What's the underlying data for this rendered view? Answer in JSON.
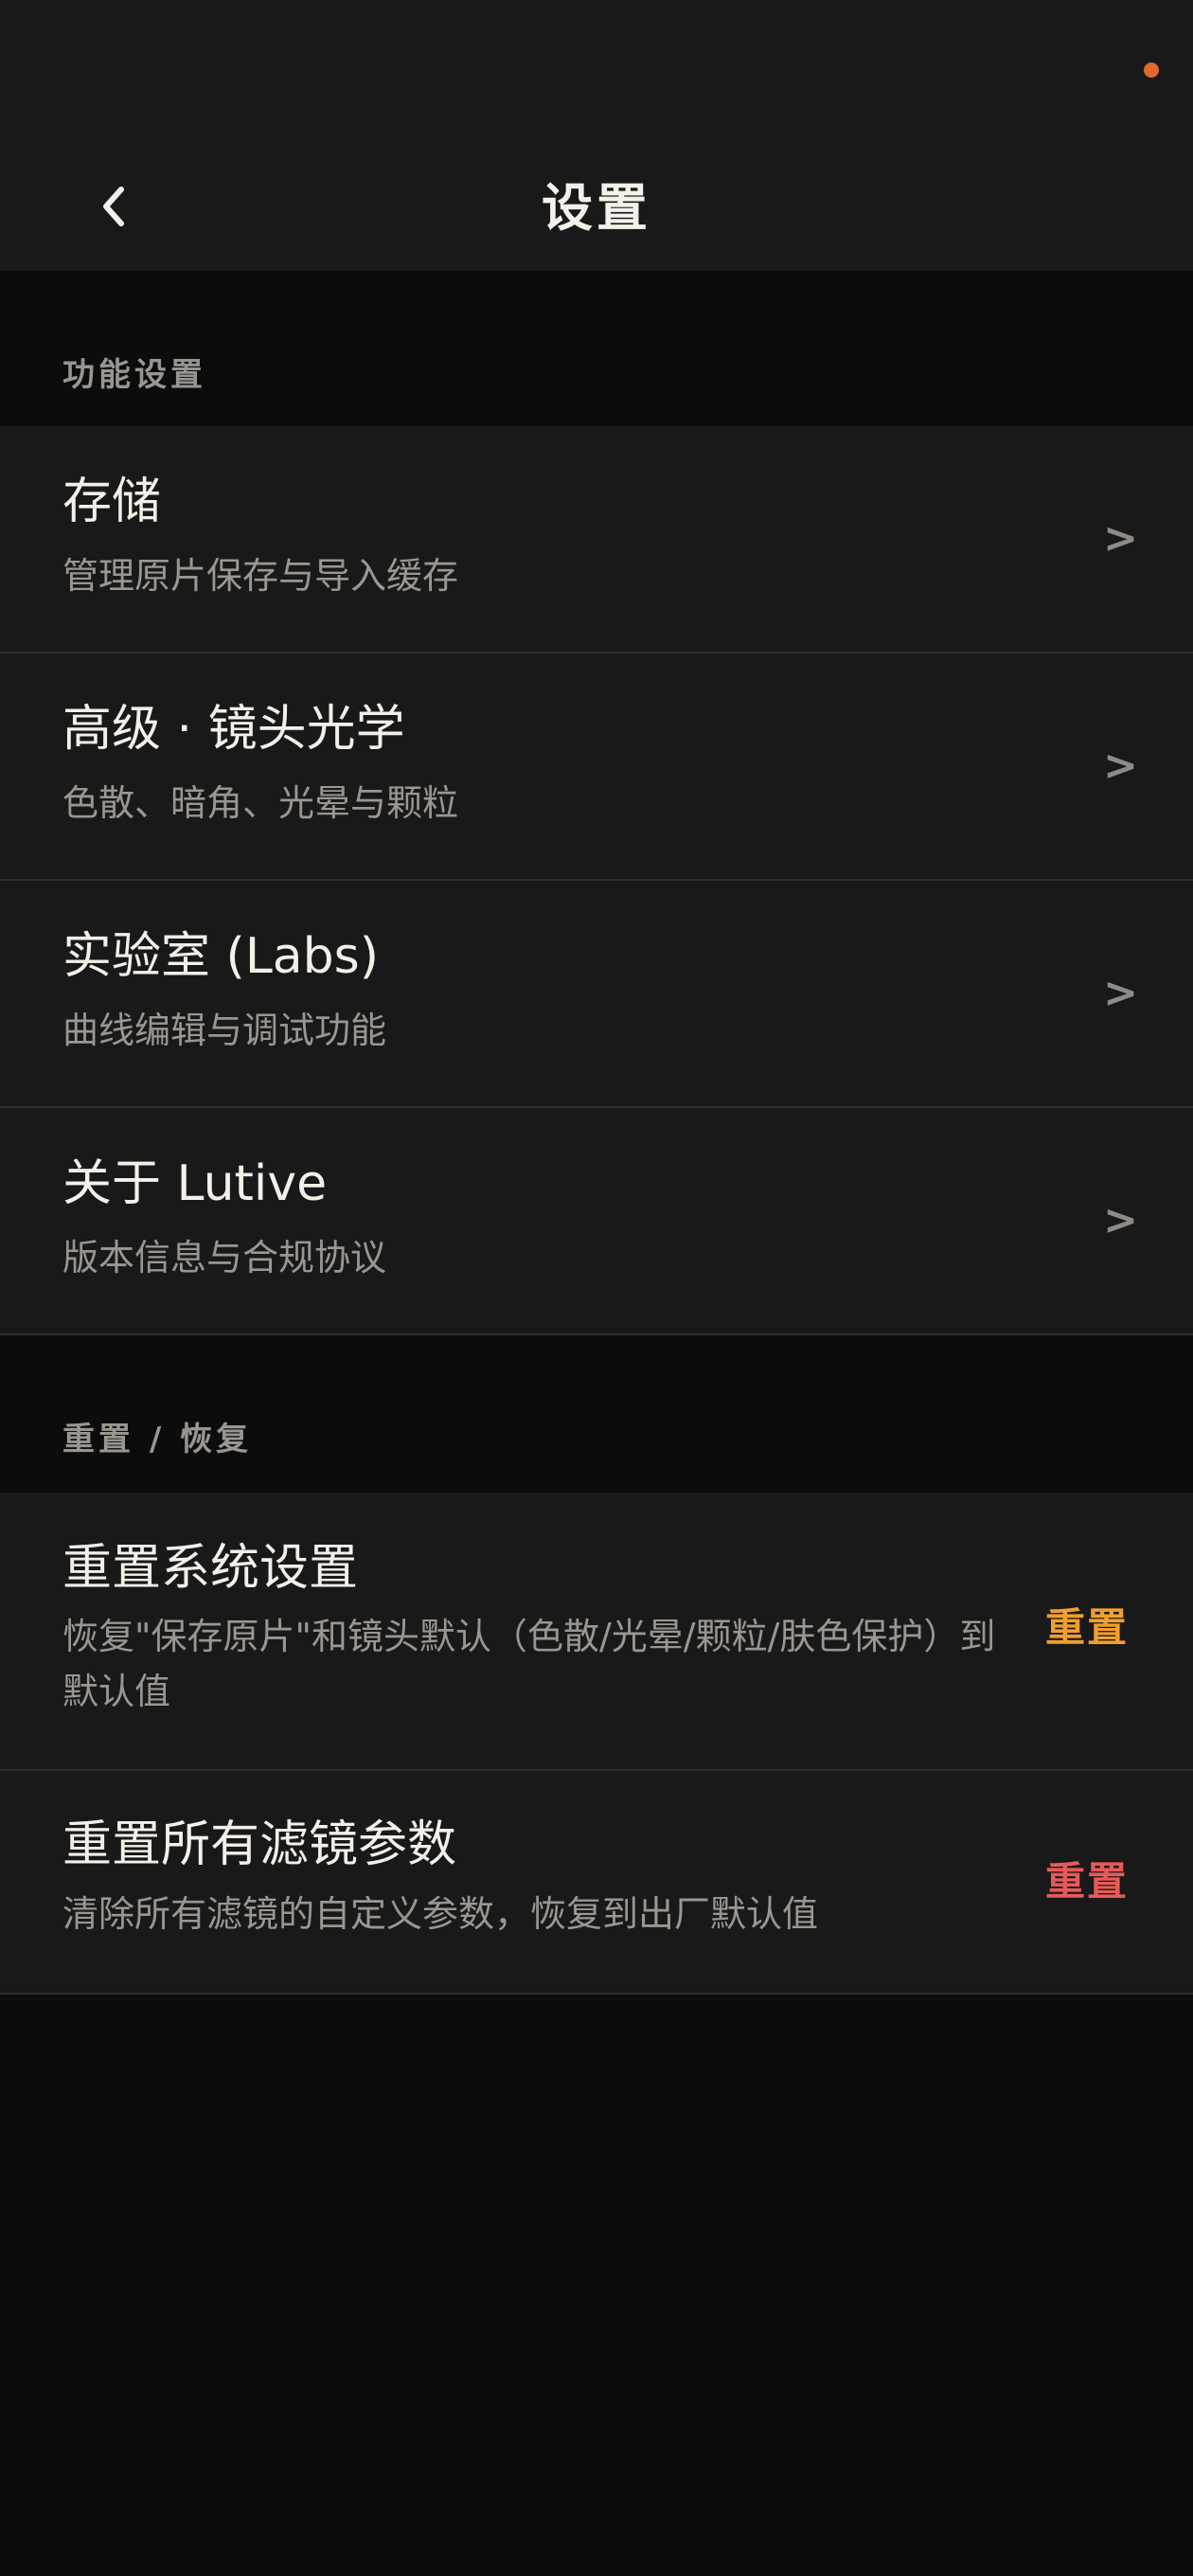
{
  "status_bar": {
    "indicator_color": "#e0692e"
  },
  "header": {
    "back_icon": "chevron-left-icon",
    "title": "设置"
  },
  "sections": {
    "features": {
      "label": "功能设置",
      "items": [
        {
          "title": "存储",
          "subtitle": "管理原片保存与导入缓存",
          "chevron": ">"
        },
        {
          "title": "高级 · 镜头光学",
          "subtitle": "色散、暗角、光晕与颗粒",
          "chevron": ">"
        },
        {
          "title": "实验室 (Labs)",
          "subtitle": "曲线编辑与调试功能",
          "chevron": ">"
        },
        {
          "title": "关于 Lutive",
          "subtitle": "版本信息与合规协议",
          "chevron": ">"
        }
      ]
    },
    "reset": {
      "label": "重置 / 恢复",
      "items": [
        {
          "title": "重置系统设置",
          "subtitle_line1": "恢复\"保存原片\"和镜头默认（色散/光晕/颗粒/肤色保护）到",
          "subtitle_line2": "默认值",
          "action": "重置",
          "action_color": "#f0a02e"
        },
        {
          "title": "重置所有滤镜参数",
          "subtitle": "清除所有滤镜的自定义参数，恢复到出厂默认值",
          "action": "重置",
          "action_color": "#e85a5a"
        }
      ]
    }
  }
}
